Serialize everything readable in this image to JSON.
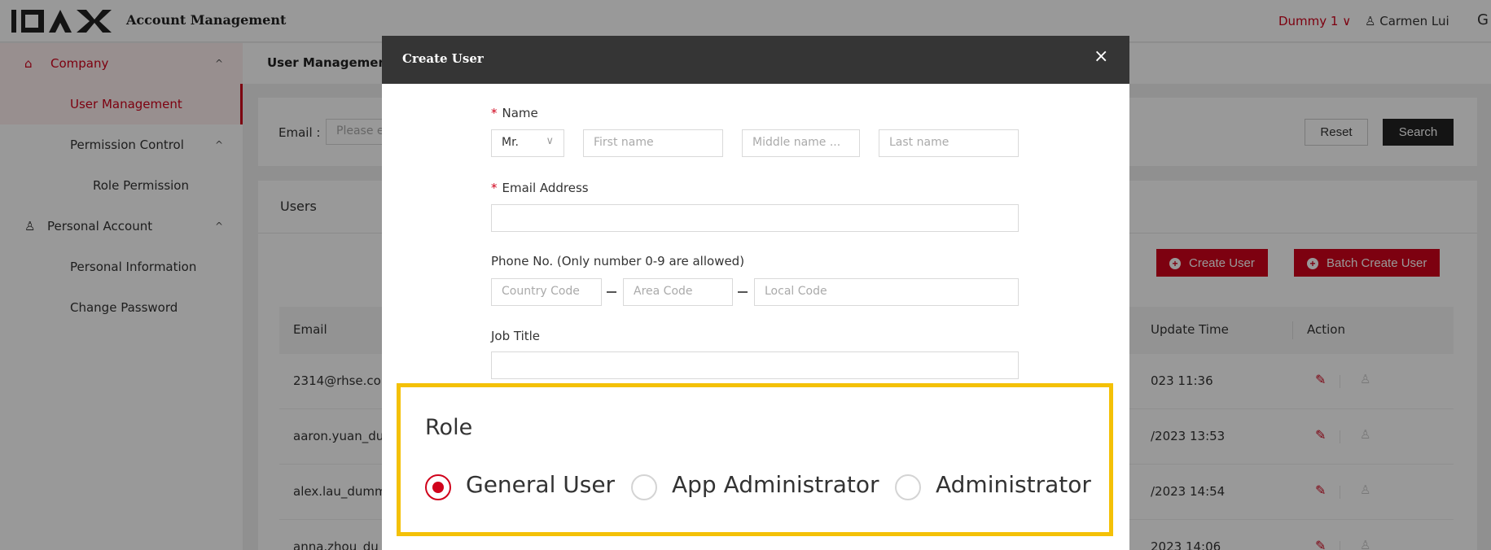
{
  "header": {
    "app_title": "Account Management",
    "tenant": "Dummy 1 ∨",
    "user_name": "Carmen Lui",
    "logout_glyph": "G"
  },
  "sidebar": {
    "items": [
      {
        "label": "Company",
        "icon": "home-icon",
        "arrow": "^"
      },
      {
        "label": "User Management"
      },
      {
        "label": "Permission Control",
        "arrow": "^"
      },
      {
        "label": "Role Permission"
      },
      {
        "label": "Personal Account",
        "icon": "user-icon",
        "arrow": "^"
      },
      {
        "label": "Personal Information"
      },
      {
        "label": "Change Password"
      }
    ]
  },
  "breadcrumb": "User Management",
  "filter": {
    "email_label": "Email :",
    "email_placeholder": "Please e",
    "reset_label": "Reset",
    "search_label": "Search"
  },
  "users": {
    "title": "Users",
    "create_label": "Create User",
    "batch_create_label": "Batch Create User",
    "columns": [
      "Email",
      "Update Time",
      "Action"
    ],
    "rows": [
      {
        "email": "2314@rhse.co",
        "update_time": "023 11:36"
      },
      {
        "email": "aaron.yuan_du",
        "update_time": "/2023 13:53"
      },
      {
        "email": "alex.lau_dumm",
        "update_time": "/2023 14:54"
      },
      {
        "email": "anna.zhou_du",
        "update_time": "2023 14:06"
      }
    ]
  },
  "modal": {
    "title": "Create User",
    "close": "×",
    "name_label": "Name",
    "title_value": "Mr.",
    "first_name_placeholder": "First name",
    "middle_name_placeholder": "Middle name ...",
    "last_name_placeholder": "Last name",
    "email_label": "Email Address",
    "phone_label": "Phone No. (Only number 0-9 are allowed)",
    "country_code_placeholder": "Country Code",
    "area_code_placeholder": "Area Code",
    "local_code_placeholder": "Local Code",
    "job_title_label": "Job Title",
    "required_mark": "*"
  },
  "role": {
    "label": "Role",
    "options": [
      "General User",
      "App Administrator",
      "Administrator"
    ],
    "selected": "General User"
  },
  "colors": {
    "accent": "#d0021b",
    "highlight": "#f4c107",
    "modal_header": "#353535"
  }
}
